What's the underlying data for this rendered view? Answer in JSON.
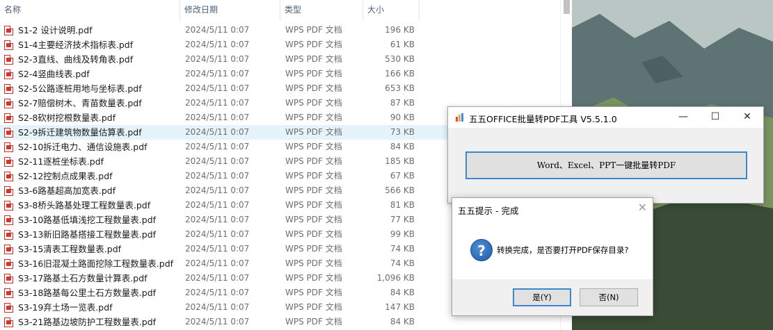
{
  "explorer": {
    "columns": {
      "name": "名称",
      "date": "修改日期",
      "type": "类型",
      "size": "大小"
    },
    "files": [
      {
        "name": "S1-2  设计说明.pdf",
        "date": "2024/5/11 0:07",
        "type": "WPS PDF 文档",
        "size": "196 KB"
      },
      {
        "name": "S1-4主要经济技术指标表.pdf",
        "date": "2024/5/11 0:07",
        "type": "WPS PDF 文档",
        "size": "61 KB"
      },
      {
        "name": "S2-3直线、曲线及转角表.pdf",
        "date": "2024/5/11 0:07",
        "type": "WPS PDF 文档",
        "size": "530 KB"
      },
      {
        "name": "S2-4竖曲线表.pdf",
        "date": "2024/5/11 0:07",
        "type": "WPS PDF 文档",
        "size": "166 KB"
      },
      {
        "name": "S2-5公路逐桩用地与坐标表.pdf",
        "date": "2024/5/11 0:07",
        "type": "WPS PDF 文档",
        "size": "653 KB"
      },
      {
        "name": "S2-7赔偿树木、青苗数量表.pdf",
        "date": "2024/5/11 0:07",
        "type": "WPS PDF 文档",
        "size": "87 KB"
      },
      {
        "name": "S2-8砍树挖根数量表.pdf",
        "date": "2024/5/11 0:07",
        "type": "WPS PDF 文档",
        "size": "90 KB"
      },
      {
        "name": "S2-9拆迁建筑物数量估算表.pdf",
        "date": "2024/5/11 0:07",
        "type": "WPS PDF 文档",
        "size": "73 KB"
      },
      {
        "name": "S2-10拆迁电力、通信设施表.pdf",
        "date": "2024/5/11 0:07",
        "type": "WPS PDF 文档",
        "size": "84 KB"
      },
      {
        "name": "S2-11逐桩坐标表.pdf",
        "date": "2024/5/11 0:07",
        "type": "WPS PDF 文档",
        "size": "185 KB"
      },
      {
        "name": "S2-12控制点成果表.pdf",
        "date": "2024/5/11 0:07",
        "type": "WPS PDF 文档",
        "size": "67 KB"
      },
      {
        "name": "S3-6路基超高加宽表.pdf",
        "date": "2024/5/11 0:07",
        "type": "WPS PDF 文档",
        "size": "566 KB"
      },
      {
        "name": "S3-8桥头路基处理工程数量表.pdf",
        "date": "2024/5/11 0:07",
        "type": "WPS PDF 文档",
        "size": "81 KB"
      },
      {
        "name": "S3-10路基低填浅挖工程数量表.pdf",
        "date": "2024/5/11 0:07",
        "type": "WPS PDF 文档",
        "size": "77 KB"
      },
      {
        "name": "S3-13新旧路基搭接工程数量表.pdf",
        "date": "2024/5/11 0:07",
        "type": "WPS PDF 文档",
        "size": "99 KB"
      },
      {
        "name": "S3-15清表工程数量表.pdf",
        "date": "2024/5/11 0:07",
        "type": "WPS PDF 文档",
        "size": "74 KB"
      },
      {
        "name": "S3-16旧混凝土路面挖除工程数量表.pdf",
        "date": "2024/5/11 0:07",
        "type": "WPS PDF 文档",
        "size": "74 KB"
      },
      {
        "name": "S3-17路基土石方数量计算表.pdf",
        "date": "2024/5/11 0:07",
        "type": "WPS PDF 文档",
        "size": "1,096 KB"
      },
      {
        "name": "S3-18路基每公里土石方数量表.pdf",
        "date": "2024/5/11 0:07",
        "type": "WPS PDF 文档",
        "size": "84 KB"
      },
      {
        "name": "S3-19弃土场一览表.pdf",
        "date": "2024/5/11 0:07",
        "type": "WPS PDF 文档",
        "size": "147 KB"
      },
      {
        "name": "S3-21路基边坡防护工程数量表.pdf",
        "date": "2024/5/11 0:07",
        "type": "WPS PDF 文档",
        "size": "84 KB"
      }
    ],
    "selected_index": 7
  },
  "tool_window": {
    "title": "五五OFFICE批量转PDF工具   V5.5.1.0",
    "minimize": "—",
    "maximize": "☐",
    "close": "✕",
    "convert_button": "Word、Excel、PPT一键批量转PDF"
  },
  "dialog": {
    "title": "五五提示 - 完成",
    "close": "✕",
    "icon": "question-icon",
    "icon_glyph": "?",
    "message": "转换完成，是否要打开PDF保存目录?",
    "yes_button": "是(Y)",
    "no_button": "否(N)"
  },
  "colors": {
    "accent": "#3a87d0",
    "selected_row": "#e5f3fb",
    "pdf_icon": "#d9342b"
  }
}
